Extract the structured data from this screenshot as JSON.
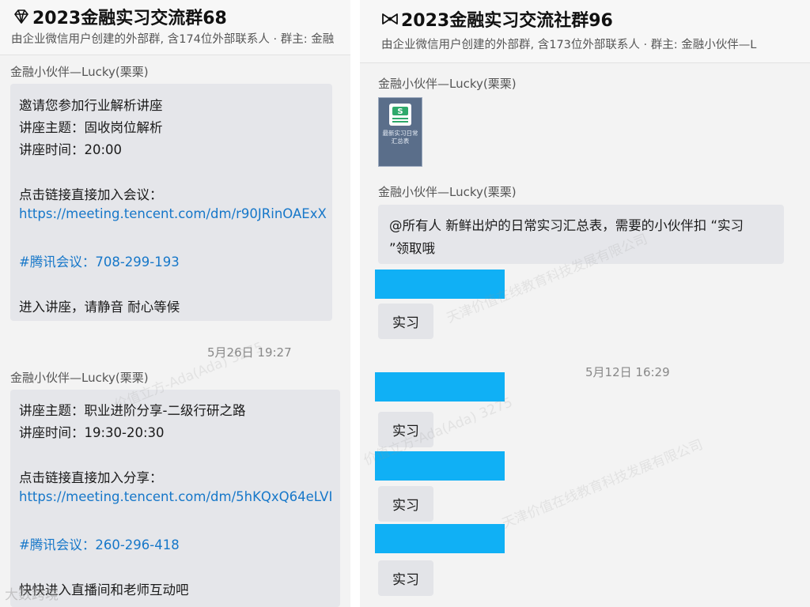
{
  "left_chat": {
    "title": "2023金融实习交流群68",
    "subtitle": "由企业微信用户创建的外部群, 含174位外部联系人 · 群主: 金融",
    "messages": [
      {
        "sender": "金融小伙伴—Lucky(栗栗)",
        "lines": [
          "邀请您参加行业解析讲座",
          "讲座主题：固收岗位解析",
          "讲座时间：20:00",
          "点击链接直接加入会议：",
          "https://meeting.tencent.com/dm/r90JRinOAExX",
          "#腾讯会议：708-299-193",
          "进入讲座，请静音 耐心等候"
        ]
      },
      {
        "sender": "金融小伙伴—Lucky(栗栗)",
        "lines": [
          "讲座主题：职业进阶分享-二级行研之路",
          "讲座时间：19:30-20:30",
          "点击链接直接加入分享：",
          "https://meeting.tencent.com/dm/5hKQxQ64eLVI",
          "#腾讯会议：260-296-418",
          "快快进入直播间和老师互动吧"
        ]
      }
    ],
    "timestamp": "5月26日 19:27"
  },
  "right_chat": {
    "title": "2023金融实习交流社群96",
    "subtitle": "由企业微信用户创建的外部群, 含173位外部联系人 · 群主: 金融小伙伴—L",
    "messages": [
      {
        "sender": "金融小伙伴—Lucky(栗栗)",
        "file": {
          "icon_label": "S",
          "name": "最新实习日常汇总表"
        }
      },
      {
        "sender": "金融小伙伴—Lucky(栗栗)",
        "lines": [
          "@所有人  新鲜出炉的日常实习汇总表，需要的小伙伴扣 “实习",
          "”领取哦"
        ]
      }
    ],
    "reply_word": "实习",
    "timestamp": "5月12日 16:29"
  },
  "watermarks": {
    "company": "天津价值在线教育科技发展有限公司",
    "name": "价值立方-Ada(Ada) 3275",
    "corner": "大数跨境"
  },
  "colors": {
    "link": "#1677c9",
    "bubble": "#e5e6ea",
    "redacted_bar": "#10b0f5",
    "background": "#f3f3f3"
  },
  "icons": {
    "left_title_icon": "diamond-icon",
    "right_title_icon": "bow-icon"
  }
}
